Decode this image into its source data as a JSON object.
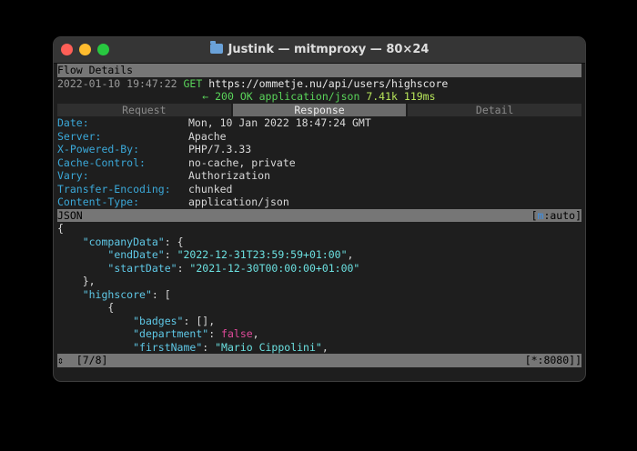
{
  "window": {
    "title": "Justink — mitmproxy — 80×24",
    "folder_icon": "folder-icon"
  },
  "flow": {
    "section_title": "Flow Details",
    "timestamp": "2022-01-10 19:47:22",
    "method": "GET",
    "url": "https://ommetje.nu/api/users/highscore",
    "arrow": "←",
    "status": "200 OK",
    "content_type": "application/json",
    "size": "7.41k",
    "time": "119ms"
  },
  "tabs": [
    {
      "label": "Request"
    },
    {
      "label": "Response"
    },
    {
      "label": "Detail"
    }
  ],
  "headers": [
    {
      "name": "Date:",
      "value": "Mon, 10 Jan 2022 18:47:24 GMT"
    },
    {
      "name": "Server:",
      "value": "Apache"
    },
    {
      "name": "X-Powered-By:",
      "value": "PHP/7.3.33"
    },
    {
      "name": "Cache-Control:",
      "value": "no-cache, private"
    },
    {
      "name": "Vary:",
      "value": "Authorization"
    },
    {
      "name": "Transfer-Encoding:",
      "value": "chunked"
    },
    {
      "name": "Content-Type:",
      "value": "application/json"
    }
  ],
  "json_bar": {
    "label": "JSON",
    "mode_open": "[",
    "mode_key": "m",
    "mode_value": ":auto]"
  },
  "body": {
    "open_brace": "{",
    "company_key": "\"companyData\"",
    "company_open": ": {",
    "end_key": "\"endDate\"",
    "end_val": "\"2022-12-31T23:59:59+01:00\"",
    "start_key": "\"startDate\"",
    "start_val": "\"2021-12-30T00:00:00+01:00\"",
    "company_close": "},",
    "highscore_key": "\"highscore\"",
    "highscore_open": ": [",
    "item_open": "{",
    "badges_key": "\"badges\"",
    "badges_val": "[],",
    "department_key": "\"department\"",
    "department_val": "false",
    "first_key": "\"firstName\"",
    "first_val": "\"Mario Cippolini\""
  },
  "status_bar": {
    "arrow": "⇕",
    "position": "[7/8]",
    "listen": "[*:8080]]"
  }
}
